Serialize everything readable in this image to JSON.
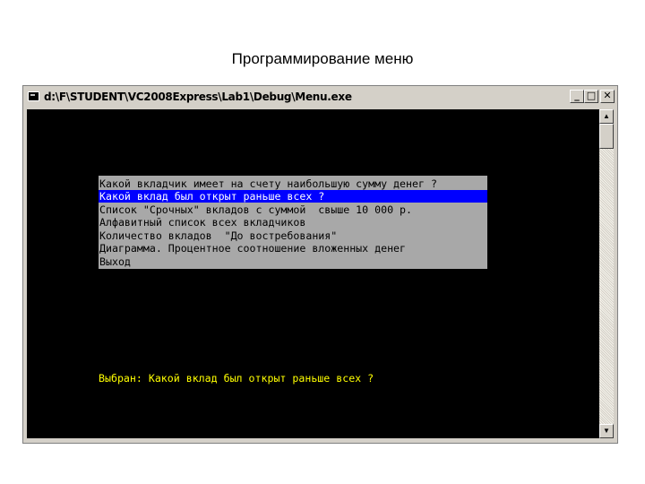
{
  "slide": {
    "title": "Программирование меню"
  },
  "window": {
    "title": "d:\\F\\STUDENT\\VC2008Express\\Lab1\\Debug\\Menu.exe",
    "minimize_glyph": "_",
    "maximize_glyph": "□",
    "close_glyph": "✕"
  },
  "menu": {
    "items": [
      {
        "label": "Какой вкладчик имеет на счету наибольшую сумму денег ?",
        "selected": false
      },
      {
        "label": "Какой вклад был открыт раньше всех ?",
        "selected": true
      },
      {
        "label": "Список \"Срочных\" вкладов с суммой  свыше 10 000 р.",
        "selected": false
      },
      {
        "label": "Алфавитный список всех вкладчиков",
        "selected": false
      },
      {
        "label": "Количество вкладов  \"До востребования\"",
        "selected": false
      },
      {
        "label": "Диаграмма. Процентное соотношение вложенных денег",
        "selected": false
      },
      {
        "label": "Выход",
        "selected": false
      }
    ]
  },
  "status": {
    "text": "Выбран: Какой вклад был открыт раньше всех ?"
  },
  "scrollbar": {
    "up_glyph": "▲",
    "down_glyph": "▼"
  },
  "colors": {
    "console_bg": "#000000",
    "menu_bg": "#a8a8a8",
    "selection": "#0000ff",
    "status_text": "#ffff00"
  }
}
